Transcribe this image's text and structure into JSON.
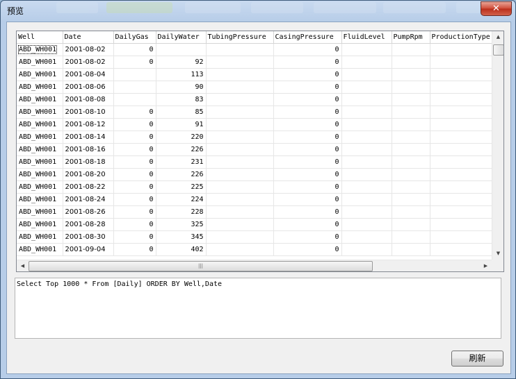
{
  "window": {
    "title": "预览",
    "close_label": "✕"
  },
  "grid": {
    "columns": [
      "Well",
      "Date",
      "DailyGas",
      "DailyWater",
      "TubingPressure",
      "CasingPressure",
      "FluidLevel",
      "PumpRpm",
      "ProductionType"
    ],
    "rows": [
      [
        "ABD_WH001",
        "2001-08-02",
        "0",
        "",
        "",
        "0",
        "",
        "",
        ""
      ],
      [
        "ABD_WH001",
        "2001-08-02",
        "0",
        "92",
        "",
        "0",
        "",
        "",
        ""
      ],
      [
        "ABD_WH001",
        "2001-08-04",
        "",
        "113",
        "",
        "0",
        "",
        "",
        ""
      ],
      [
        "ABD_WH001",
        "2001-08-06",
        "",
        "90",
        "",
        "0",
        "",
        "",
        ""
      ],
      [
        "ABD_WH001",
        "2001-08-08",
        "",
        "83",
        "",
        "0",
        "",
        "",
        ""
      ],
      [
        "ABD_WH001",
        "2001-08-10",
        "0",
        "85",
        "",
        "0",
        "",
        "",
        ""
      ],
      [
        "ABD_WH001",
        "2001-08-12",
        "0",
        "91",
        "",
        "0",
        "",
        "",
        ""
      ],
      [
        "ABD_WH001",
        "2001-08-14",
        "0",
        "220",
        "",
        "0",
        "",
        "",
        ""
      ],
      [
        "ABD_WH001",
        "2001-08-16",
        "0",
        "226",
        "",
        "0",
        "",
        "",
        ""
      ],
      [
        "ABD_WH001",
        "2001-08-18",
        "0",
        "231",
        "",
        "0",
        "",
        "",
        ""
      ],
      [
        "ABD_WH001",
        "2001-08-20",
        "0",
        "226",
        "",
        "0",
        "",
        "",
        ""
      ],
      [
        "ABD_WH001",
        "2001-08-22",
        "0",
        "225",
        "",
        "0",
        "",
        "",
        ""
      ],
      [
        "ABD_WH001",
        "2001-08-24",
        "0",
        "224",
        "",
        "0",
        "",
        "",
        ""
      ],
      [
        "ABD_WH001",
        "2001-08-26",
        "0",
        "228",
        "",
        "0",
        "",
        "",
        ""
      ],
      [
        "ABD_WH001",
        "2001-08-28",
        "0",
        "325",
        "",
        "0",
        "",
        "",
        ""
      ],
      [
        "ABD_WH001",
        "2001-08-30",
        "0",
        "345",
        "",
        "0",
        "",
        "",
        ""
      ],
      [
        "ABD_WH001",
        "2001-09-04",
        "0",
        "402",
        "",
        "0",
        "",
        "",
        ""
      ]
    ],
    "scroll_icons": {
      "up": "▲",
      "down": "▼",
      "left": "◀",
      "right": "▶",
      "grip": "|||"
    }
  },
  "sql": {
    "text": "Select Top 1000 * From [Daily] ORDER BY Well,Date"
  },
  "buttons": {
    "refresh_label": "刷新"
  }
}
